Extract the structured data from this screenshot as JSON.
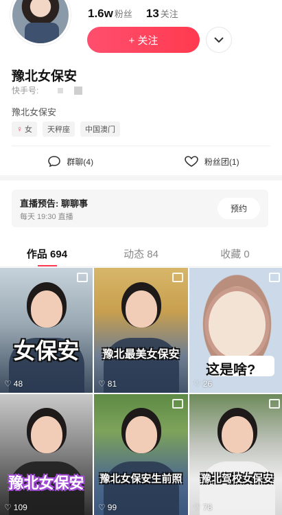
{
  "profile": {
    "followers_num": "1.6w",
    "followers_label": "粉丝",
    "following_num": "13",
    "following_label": "关注",
    "follow_label": "+ 关注",
    "name": "豫北女保安",
    "kuaishou_id_label": "快手号:",
    "bio": "豫北女保安",
    "tags": [
      "女",
      "天秤座",
      "中国澳门"
    ]
  },
  "social": {
    "group_chat": "群聊(4)",
    "fan_club": "粉丝团(1)"
  },
  "live": {
    "title": "直播预告: 聊聊事",
    "time": "每天 19:30 直播",
    "reserve_label": "预约"
  },
  "tabs": [
    {
      "label": "作品 694",
      "active": true
    },
    {
      "label": "动态 84",
      "active": false
    },
    {
      "label": "收藏 0",
      "active": false
    }
  ],
  "videos": [
    {
      "caption": "女保安",
      "likes": "48"
    },
    {
      "caption": "豫北最美女保安",
      "likes": "81"
    },
    {
      "caption": "这是啥?",
      "likes": "26"
    },
    {
      "caption": "豫北女保安",
      "likes": "109"
    },
    {
      "caption": "豫北女保安生前照",
      "likes": "99"
    },
    {
      "caption": "豫北驾校女保安",
      "likes": "78"
    }
  ],
  "colors": {
    "accent": "#ff3b55",
    "follow_button": "#ff4f6e"
  }
}
